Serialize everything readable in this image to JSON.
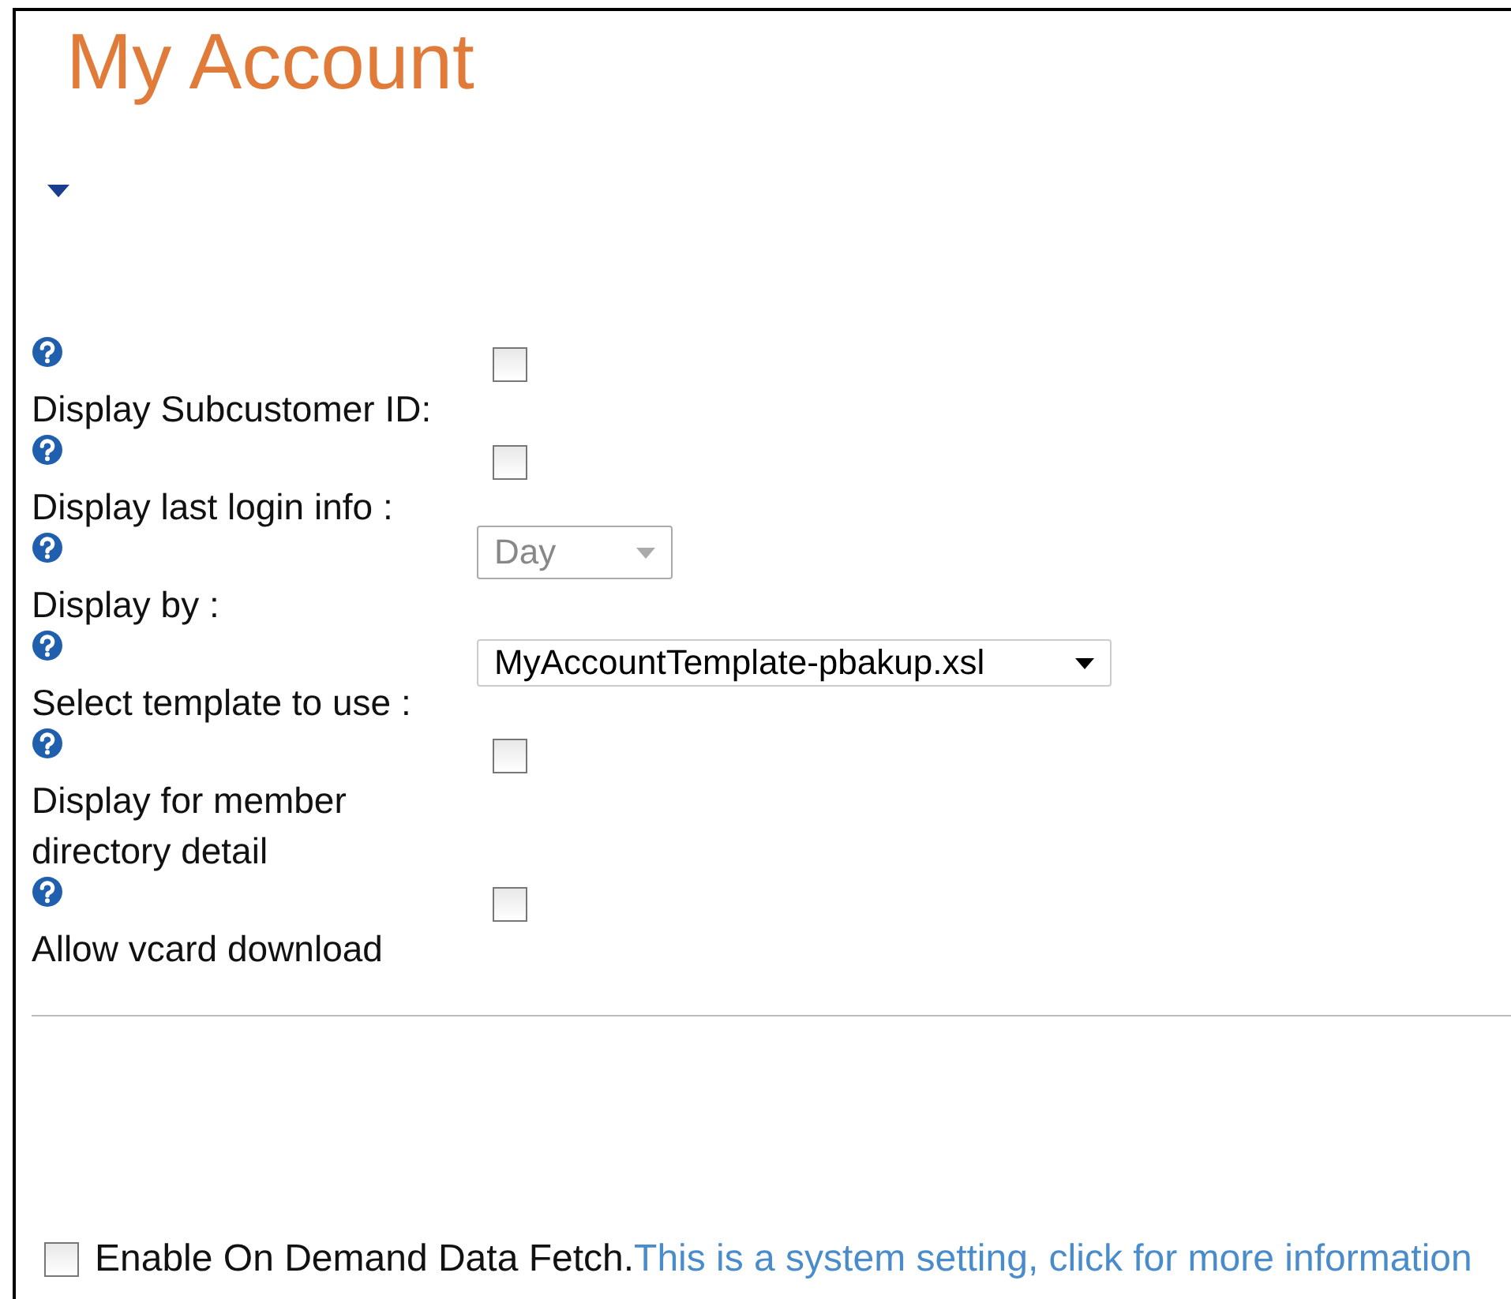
{
  "title": "My Account",
  "rows": [
    {
      "kind": "checkbox",
      "label": "Display Subcustomer ID:",
      "checked": false
    },
    {
      "kind": "checkbox",
      "label": "Display last login info :",
      "checked": false
    },
    {
      "kind": "select",
      "label": "Display by :",
      "value": "Day",
      "disabled": true
    },
    {
      "kind": "select",
      "label": "Select template to use :",
      "value": "MyAccountTemplate-pbakup.xsl",
      "disabled": false
    },
    {
      "kind": "checkbox",
      "label": "Display for member directory detail",
      "checked": false
    },
    {
      "kind": "checkbox",
      "label": "Allow vcard download",
      "checked": false
    }
  ],
  "footer": {
    "checked": false,
    "label": "Enable On Demand Data Fetch.",
    "link": "This is a system setting, click for more information"
  }
}
